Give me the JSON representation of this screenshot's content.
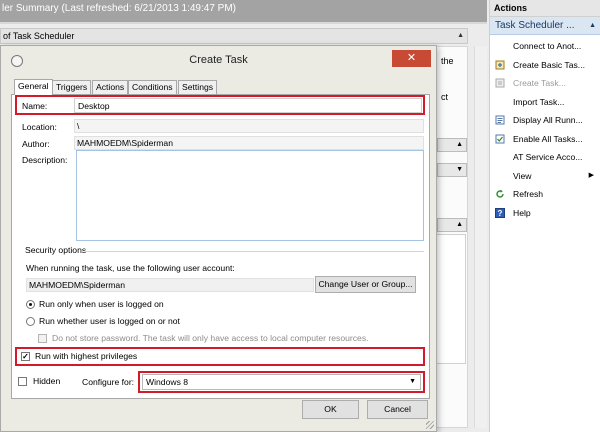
{
  "background": {
    "summary_header": "ler Summary (Last refreshed: 6/21/2013 1:49:47 PM)",
    "section_title": "of Task Scheduler",
    "fragment_the": "the",
    "fragment_ct": "ct"
  },
  "actions_pane": {
    "title": "Actions",
    "group_title": "Task Scheduler ...",
    "items": [
      {
        "label": "Connect to Anot...",
        "icon": "none",
        "enabled": true
      },
      {
        "label": "Create Basic Tas...",
        "icon": "create-basic-task-icon",
        "enabled": true
      },
      {
        "label": "Create Task...",
        "icon": "create-task-icon",
        "enabled": false
      },
      {
        "label": "Import Task...",
        "icon": "none",
        "enabled": true
      },
      {
        "label": "Display All Runn...",
        "icon": "display-running-tasks-icon",
        "enabled": true
      },
      {
        "label": "Enable All Tasks...",
        "icon": "enable-all-tasks-icon",
        "enabled": true
      },
      {
        "label": "AT Service Acco...",
        "icon": "none",
        "enabled": true
      },
      {
        "label": "View",
        "icon": "none",
        "enabled": true,
        "submenu": true
      },
      {
        "label": "Refresh",
        "icon": "refresh-icon",
        "enabled": true
      },
      {
        "label": "Help",
        "icon": "help-icon",
        "enabled": true
      }
    ]
  },
  "dialog": {
    "title": "Create Task",
    "close_glyph": "✕",
    "tabs": [
      "General",
      "Triggers",
      "Actions",
      "Conditions",
      "Settings"
    ],
    "active_tab": "General",
    "general": {
      "name_label": "Name:",
      "name_value": "Desktop",
      "location_label": "Location:",
      "location_value": "\\",
      "author_label": "Author:",
      "author_value": "MAHMOEDM\\Spiderman",
      "description_label": "Description:",
      "description_value": "",
      "security_title": "Security options",
      "account_prompt": "When running the task, use the following user account:",
      "user_account": "MAHMOEDM\\Spiderman",
      "change_user_button": "Change User or Group...",
      "radio_logged_on": "Run only when user is logged on",
      "radio_logged_on_checked": true,
      "radio_whether": "Run whether user is logged on or not",
      "radio_whether_checked": false,
      "no_store_password": "Do not store password. The task will only have access to local computer resources.",
      "highest_privileges": "Run with highest privileges",
      "highest_privileges_checked": true,
      "hidden": "Hidden",
      "hidden_checked": false,
      "configure_for_label": "Configure for:",
      "configure_for_value": "Windows 8"
    },
    "ok_button": "OK",
    "cancel_button": "Cancel"
  },
  "colors": {
    "highlight": "#d11a2a",
    "close_button": "#c84a35",
    "actions_group_bg": "#dbe6f3"
  }
}
